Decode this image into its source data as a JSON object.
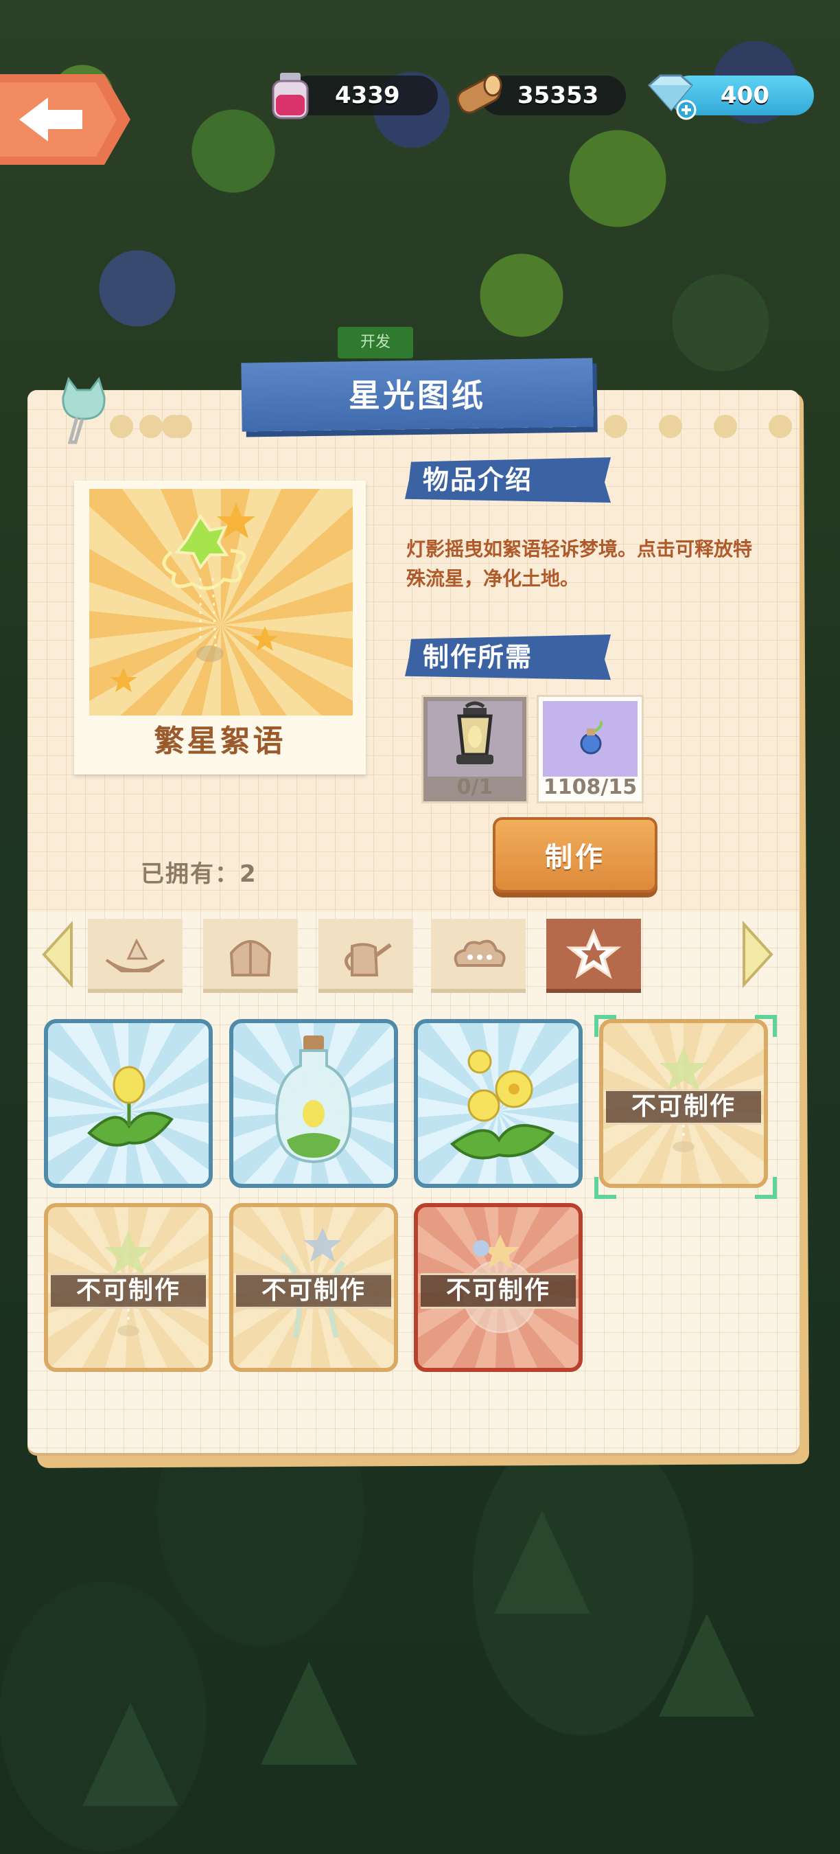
{
  "header": {
    "back_icon": "left-arrow-icon",
    "resources": [
      {
        "name": "ink-bottle",
        "icon": "ink-bottle-icon",
        "value": "4339"
      },
      {
        "name": "wood-log",
        "icon": "wood-log-icon",
        "value": "35353"
      },
      {
        "name": "diamond",
        "icon": "diamond-icon",
        "value": "400"
      }
    ]
  },
  "dev_tag": "开发",
  "panel": {
    "title": "星光图纸",
    "item_name": "繁星絮语",
    "intro_label": "物品介绍",
    "description": "灯影摇曳如絮语轻诉梦境。点击可释放特殊流星，净化土地。",
    "requirements_label": "制作所需",
    "materials": [
      {
        "name": "lantern",
        "icon": "lantern-icon",
        "count": "0/1"
      },
      {
        "name": "blue-potion",
        "icon": "potion-icon",
        "count": "1108/15"
      }
    ],
    "owned": "已拥有：2",
    "craft_button": "制作"
  },
  "tabs": [
    {
      "icon": "boat-icon",
      "active": false
    },
    {
      "icon": "bag-icon",
      "active": false
    },
    {
      "icon": "watering-can-icon",
      "active": false
    },
    {
      "icon": "cloud-icon",
      "active": false
    },
    {
      "icon": "star-icon",
      "active": true
    }
  ],
  "grid": {
    "locked_label": "不可制作",
    "items": [
      {
        "icon": "bud-sprout-icon",
        "style": "blue",
        "locked": false
      },
      {
        "icon": "bottle-sprout-icon",
        "style": "blue",
        "locked": false
      },
      {
        "icon": "yellow-flower-icon",
        "style": "blue",
        "locked": false
      },
      {
        "icon": "star-lamp-icon",
        "style": "gold",
        "locked": true,
        "selected": true
      },
      {
        "icon": "star-lamp-icon",
        "style": "gold",
        "locked": true
      },
      {
        "icon": "star-fountain-icon",
        "style": "gold",
        "locked": true
      },
      {
        "icon": "star-orb-icon",
        "style": "red",
        "locked": true
      }
    ]
  },
  "colors": {
    "accent_blue": "#3b63a3",
    "craft_orange": "#dd8a3a",
    "back_orange": "#e9764e"
  }
}
